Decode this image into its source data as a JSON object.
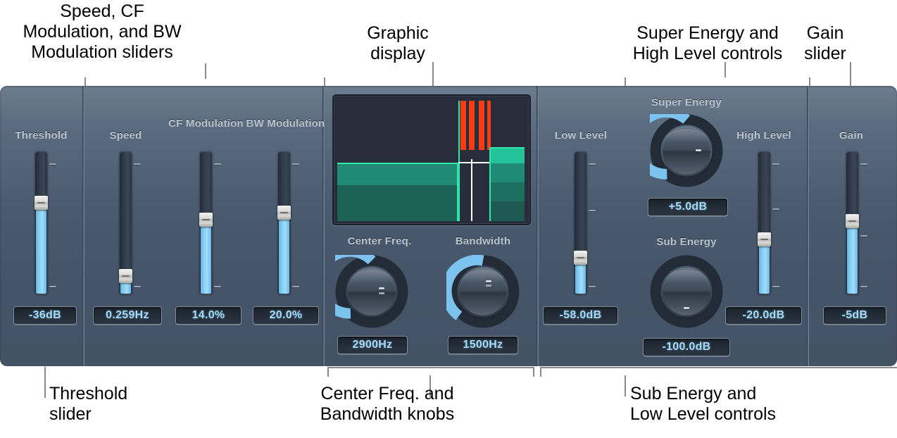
{
  "annotations": {
    "top_left": "Speed, CF\nModulation, and BW\nModulation sliders",
    "top_mid": "Graphic\ndisplay",
    "top_right": "Super Energy and\nHigh Level controls",
    "top_far_right": "Gain\nslider",
    "bottom_left": "Threshold\nslider",
    "bottom_mid": "Center Freq. and\nBandwidth knobs",
    "bottom_right": "Sub Energy and\nLow Level controls"
  },
  "controls": {
    "threshold": {
      "label": "Threshold",
      "value": "-36dB"
    },
    "speed": {
      "label": "Speed",
      "value": "0.259Hz"
    },
    "cf_modulation": {
      "label": "CF\nModulation",
      "value": "14.0%"
    },
    "bw_modulation": {
      "label": "BW\nModulation",
      "value": "20.0%"
    },
    "center_freq": {
      "label": "Center Freq.",
      "value": "2900Hz"
    },
    "bandwidth": {
      "label": "Bandwidth",
      "value": "1500Hz"
    },
    "low_level": {
      "label": "Low Level",
      "value": "-58.0dB"
    },
    "super_energy": {
      "label": "Super Energy",
      "value": "+5.0dB"
    },
    "sub_energy": {
      "label": "Sub Energy",
      "value": "-100.0dB"
    },
    "high_level": {
      "label": "High Level",
      "value": "-20.0dB"
    },
    "gain": {
      "label": "Gain",
      "value": "-5dB"
    }
  },
  "colors": {
    "panel_top": "#6d7c8e",
    "panel_bottom": "#445266",
    "slider_fill": "#86cdf2",
    "value_text": "#a7d9f5",
    "label_text": "#b9c3ce",
    "knob_arc": "#7cc3ef",
    "display_bg": "#272d3a",
    "display_green": "#20c997",
    "display_red": "#f03a17"
  },
  "graphic_display": {
    "background": "#272d3a",
    "green_outline": "#2ee6a8",
    "red_bar_color": "#f53c14",
    "cursor_color": "#ffffff",
    "red_bar_count": 4,
    "bands": [
      {
        "name": "low-band",
        "shade_top": "#1f8b74",
        "shade_bottom": "#1c6b5e"
      },
      {
        "name": "high-band",
        "shade_top": "#23c49a",
        "shade_bottom": "#1d5f55"
      }
    ]
  }
}
